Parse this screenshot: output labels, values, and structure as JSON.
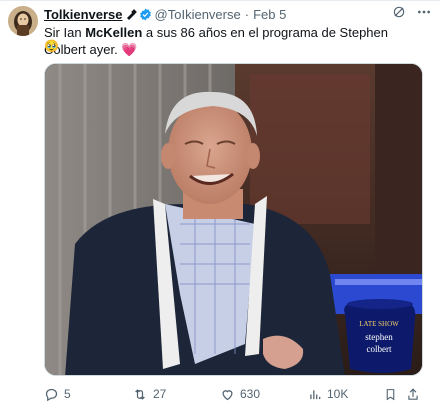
{
  "tweet": {
    "display_name": "Tolkienverse",
    "handle": "@ToIkienverse",
    "date": "Feb 5",
    "text_before": "Sir Ian ",
    "text_bold": "McKellen",
    "text_after": " a sus 86 años en el programa de Stephen Colbert ayer. ",
    "emoji_heart": "💗",
    "emoji_line2": "🥹",
    "mug_line1": "LATE SHOW",
    "mug_line2": "stephen",
    "mug_line3": "colbert"
  },
  "actions": {
    "replies": "5",
    "retweets": "27",
    "likes": "630",
    "views": "10K"
  },
  "colors": {
    "verified": "#1d9bf0",
    "muted": "#536471",
    "heart": "#e0245e"
  }
}
